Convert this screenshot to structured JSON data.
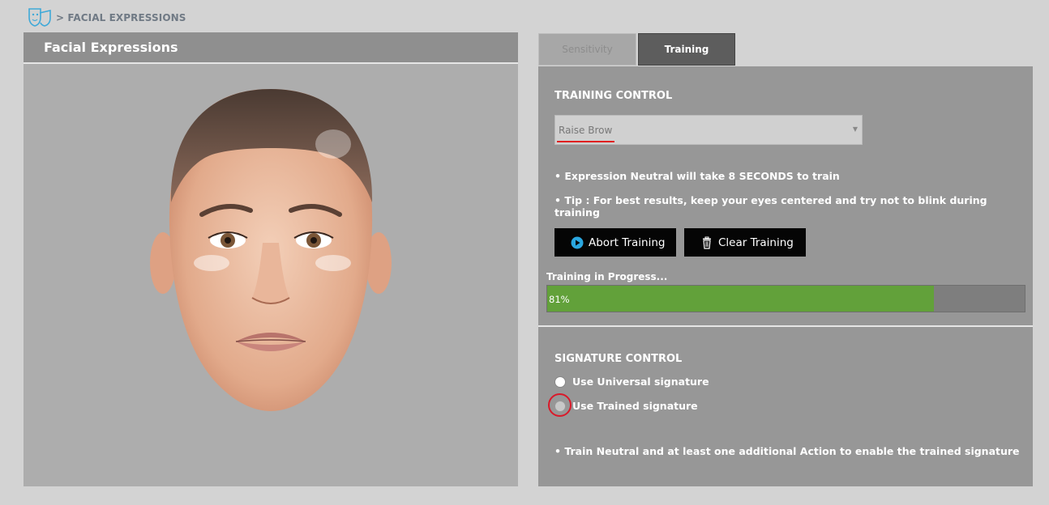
{
  "breadcrumb": {
    "text": "> FACIAL EXPRESSIONS",
    "icon": "theater-mask-icon"
  },
  "left_panel": {
    "title": "Facial Expressions",
    "image": "3d-face-avatar"
  },
  "tabs": [
    {
      "label": "Sensitivity",
      "active": false
    },
    {
      "label": "Training",
      "active": true
    }
  ],
  "training": {
    "title": "TRAINING CONTROL",
    "dropdown": {
      "value": "Raise Brow"
    },
    "info1": "• Expression Neutral will take 8 SECONDS to train",
    "info2": "• Tip : For best results, keep your eyes centered and try not to blink during training",
    "abort_button": "Abort Training",
    "clear_button": "Clear Training",
    "progress_label": "Training in Progress...",
    "progress_value": 81,
    "progress_text": "81%"
  },
  "signature": {
    "title": "SIGNATURE CONTROL",
    "option_universal": "Use Universal signature",
    "option_trained": "Use Trained signature",
    "note": "• Train Neutral and at least one additional Action to enable the trained signature"
  },
  "colors": {
    "background": "#d3d3d3",
    "panel": "#979797",
    "progress_fill": "#62a13a",
    "accent_red": "#d91a2a",
    "icon_blue": "#2aa7e0"
  }
}
